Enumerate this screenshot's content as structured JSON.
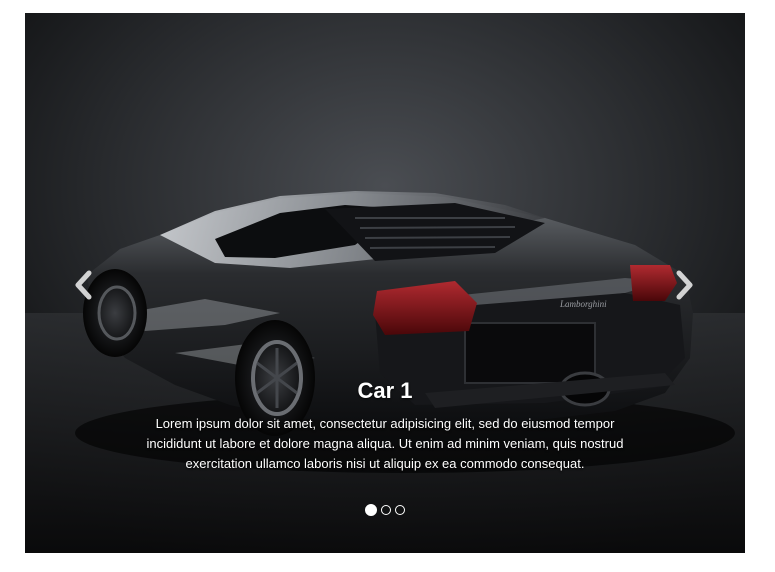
{
  "carousel": {
    "slides": [
      {
        "title": "Car 1",
        "text": "Lorem ipsum dolor sit amet, consectetur adipisicing elit, sed do eiusmod tempor incididunt ut labore et dolore magna aliqua. Ut enim ad minim veniam, quis nostrud exercitation ullamco laboris nisi ut aliquip ex ea commodo consequat.",
        "image": "black-sports-car-rear-view"
      }
    ],
    "active_index": 0,
    "indicator_count": 3,
    "prev_icon": "chevron-left-icon",
    "next_icon": "chevron-right-icon",
    "colors": {
      "background": "#0b0c0e",
      "text": "#ffffff",
      "taillight": "#7a1016"
    }
  }
}
